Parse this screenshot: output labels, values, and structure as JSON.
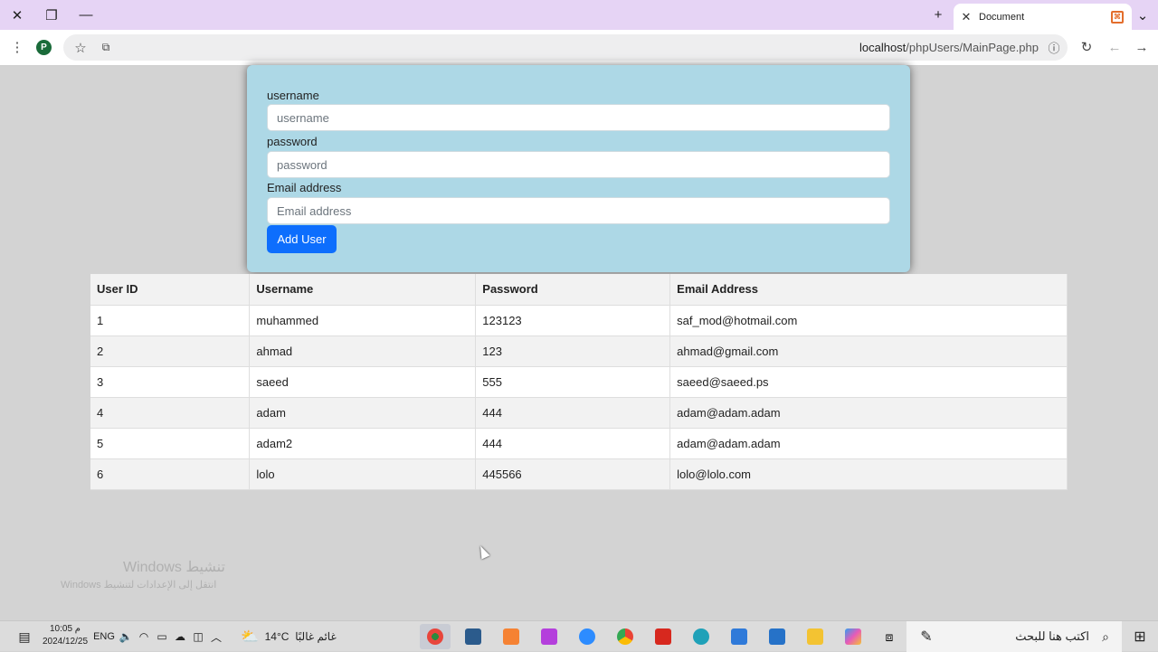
{
  "browser": {
    "tab_title": "Document",
    "url_host": "localhost",
    "url_path": "/phpUsers/MainPage.php",
    "profile_initial": "P"
  },
  "form": {
    "username_label": "username",
    "username_placeholder": "username",
    "password_label": "password",
    "password_placeholder": "password",
    "email_label": "Email address",
    "email_placeholder": "Email address",
    "submit_label": "Add User"
  },
  "table": {
    "headers": [
      "User ID",
      "Username",
      "Password",
      "Email Address"
    ],
    "rows": [
      [
        "1",
        "muhammed",
        "123123",
        "saf_mod@hotmail.com"
      ],
      [
        "2",
        "ahmad",
        "123",
        "ahmad@gmail.com"
      ],
      [
        "3",
        "saeed",
        "555",
        "saeed@saeed.ps"
      ],
      [
        "4",
        "adam",
        "444",
        "adam@adam.adam"
      ],
      [
        "5",
        "adam2",
        "444",
        "adam@adam.adam"
      ],
      [
        "6",
        "lolo",
        "445566",
        "lolo@lolo.com"
      ]
    ]
  },
  "watermark": {
    "line1": "تنشيط Windows",
    "line2": "انتقل إلى الإعدادات لتنشيط Windows"
  },
  "taskbar": {
    "time": "10:05 م",
    "date": "2024/12/25",
    "language": "ENG",
    "weather_temp": "14°C",
    "weather_text": "غائم غالبًا",
    "search_placeholder": "اكتب هنا للبحث"
  },
  "colors": {
    "card_bg": "#add8e6",
    "primary_button": "#0d6efd",
    "page_bg": "#d3d3d3"
  }
}
